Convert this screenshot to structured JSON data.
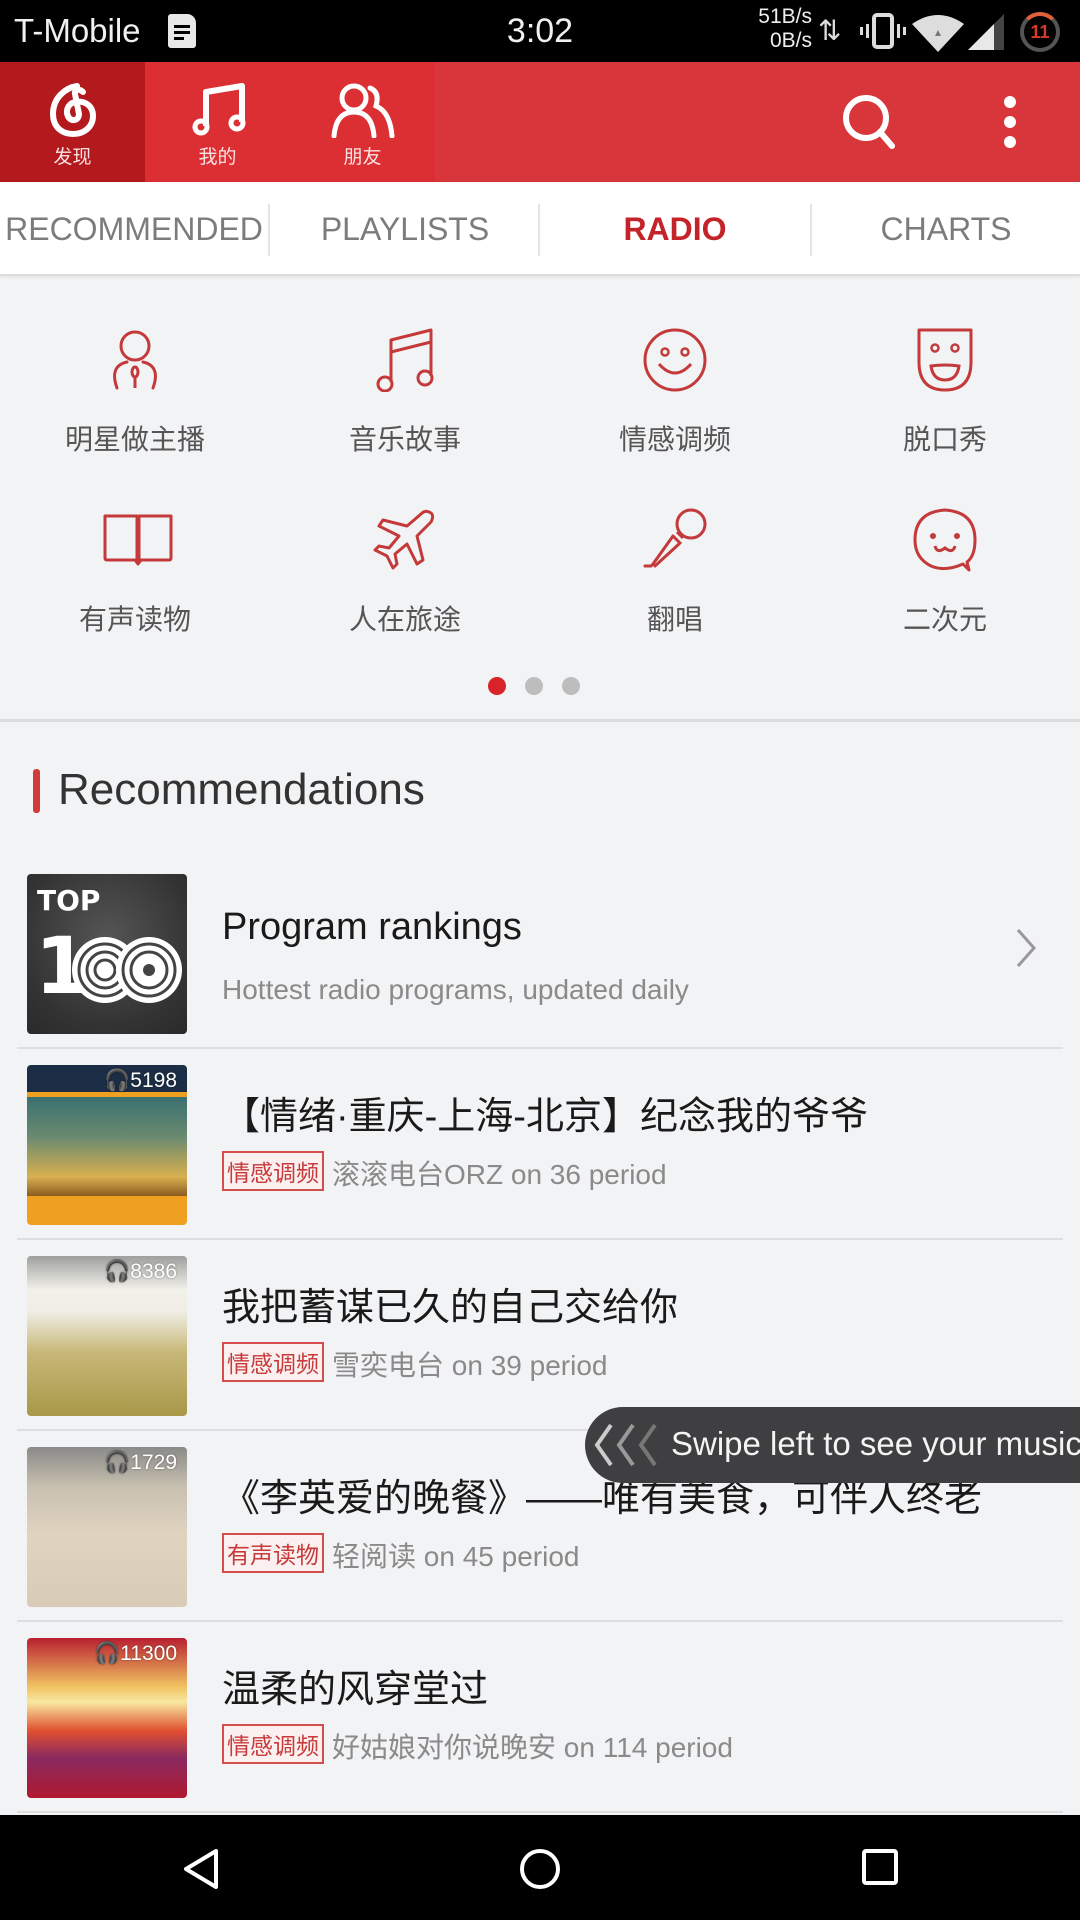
{
  "status_bar": {
    "carrier": "T-Mobile",
    "time": "3:02",
    "net_up": "51B/s",
    "net_down": "0B/s",
    "battery_badge": "11",
    "icons": [
      "sim-notification-icon",
      "data-arrows-icon",
      "vibrate-icon",
      "wifi-icon",
      "cell-signal-icon",
      "battery-circle-icon"
    ]
  },
  "app_bar": {
    "tabs": [
      {
        "label": "发现",
        "icon": "netease-logo-icon",
        "active": true
      },
      {
        "label": "我的",
        "icon": "music-note-icon",
        "active": false
      },
      {
        "label": "朋友",
        "icon": "friends-icon",
        "active": false
      }
    ],
    "actions": [
      "search-icon",
      "more-vert-icon"
    ],
    "colors": {
      "bar": "#d8363a",
      "active_tab": "#b3191d"
    }
  },
  "sub_tabs": [
    {
      "label": "RECOMMENDED",
      "active": false
    },
    {
      "label": "PLAYLISTS",
      "active": false
    },
    {
      "label": "RADIO",
      "active": true
    },
    {
      "label": "CHARTS",
      "active": false
    }
  ],
  "categories": [
    {
      "label": "明星做主播",
      "icon": "host-icon"
    },
    {
      "label": "音乐故事",
      "icon": "music-note-icon"
    },
    {
      "label": "情感调频",
      "icon": "smiley-icon"
    },
    {
      "label": "脱口秀",
      "icon": "mask-icon"
    },
    {
      "label": "有声读物",
      "icon": "book-icon"
    },
    {
      "label": "人在旅途",
      "icon": "airplane-icon"
    },
    {
      "label": "翻唱",
      "icon": "microphone-icon"
    },
    {
      "label": "二次元",
      "icon": "anime-face-icon"
    }
  ],
  "pager": {
    "pages": 3,
    "current": 1
  },
  "recommendations": {
    "title": "Recommendations",
    "ranking": {
      "title": "Program rankings",
      "subtitle": "Hottest radio programs, updated daily",
      "thumb_top": "TOP",
      "thumb_num": "1"
    },
    "items": [
      {
        "title": "【情绪·重庆-上海-北京】纪念我的爷爷",
        "tag": "情感调频",
        "source": "滚滚电台ORZ on 36 period",
        "plays": "5198"
      },
      {
        "title": "我把蓄谋已久的自己交给你",
        "tag": "情感调频",
        "source": "雪奕电台 on 39 period",
        "plays": "8386"
      },
      {
        "title": "《李英爱的晚餐》——唯有美食，可伴人终老",
        "tag": "有声读物",
        "source": "轻阅读 on 45 period",
        "plays": "1729"
      },
      {
        "title": "温柔的风穿堂过",
        "tag": "情感调频",
        "source": "好姑娘对你说晚安 on 114 period",
        "plays": "11300"
      }
    ]
  },
  "toast": {
    "text": "Swipe left to see your music"
  },
  "nav_bar": {
    "buttons": [
      "back-icon",
      "home-icon",
      "recents-icon"
    ]
  }
}
